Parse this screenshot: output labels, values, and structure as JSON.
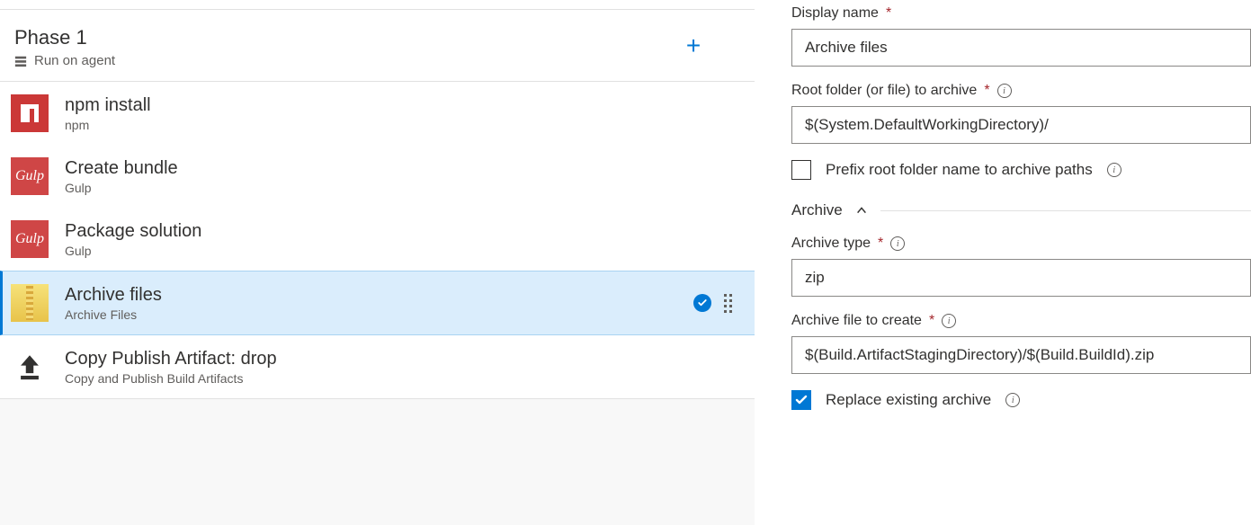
{
  "phase": {
    "title": "Phase 1",
    "subtitle": "Run on agent"
  },
  "tasks": [
    {
      "title": "npm install",
      "subtitle": "npm",
      "icon": "npm"
    },
    {
      "title": "Create bundle",
      "subtitle": "Gulp",
      "icon": "gulp"
    },
    {
      "title": "Package solution",
      "subtitle": "Gulp",
      "icon": "gulp"
    },
    {
      "title": "Archive files",
      "subtitle": "Archive Files",
      "icon": "archive",
      "selected": true,
      "enabled": true
    },
    {
      "title": "Copy Publish Artifact: drop",
      "subtitle": "Copy and Publish Build Artifacts",
      "icon": "upload"
    }
  ],
  "form": {
    "displayName": {
      "label": "Display name",
      "value": "Archive files"
    },
    "rootFolder": {
      "label": "Root folder (or file) to archive",
      "value": "$(System.DefaultWorkingDirectory)/"
    },
    "prefixRoot": {
      "label": "Prefix root folder name to archive paths",
      "checked": false
    },
    "sectionArchive": "Archive",
    "archiveType": {
      "label": "Archive type",
      "value": "zip"
    },
    "archiveFile": {
      "label": "Archive file to create",
      "value": "$(Build.ArtifactStagingDirectory)/$(Build.BuildId).zip"
    },
    "replaceExisting": {
      "label": "Replace existing archive",
      "checked": true
    }
  }
}
